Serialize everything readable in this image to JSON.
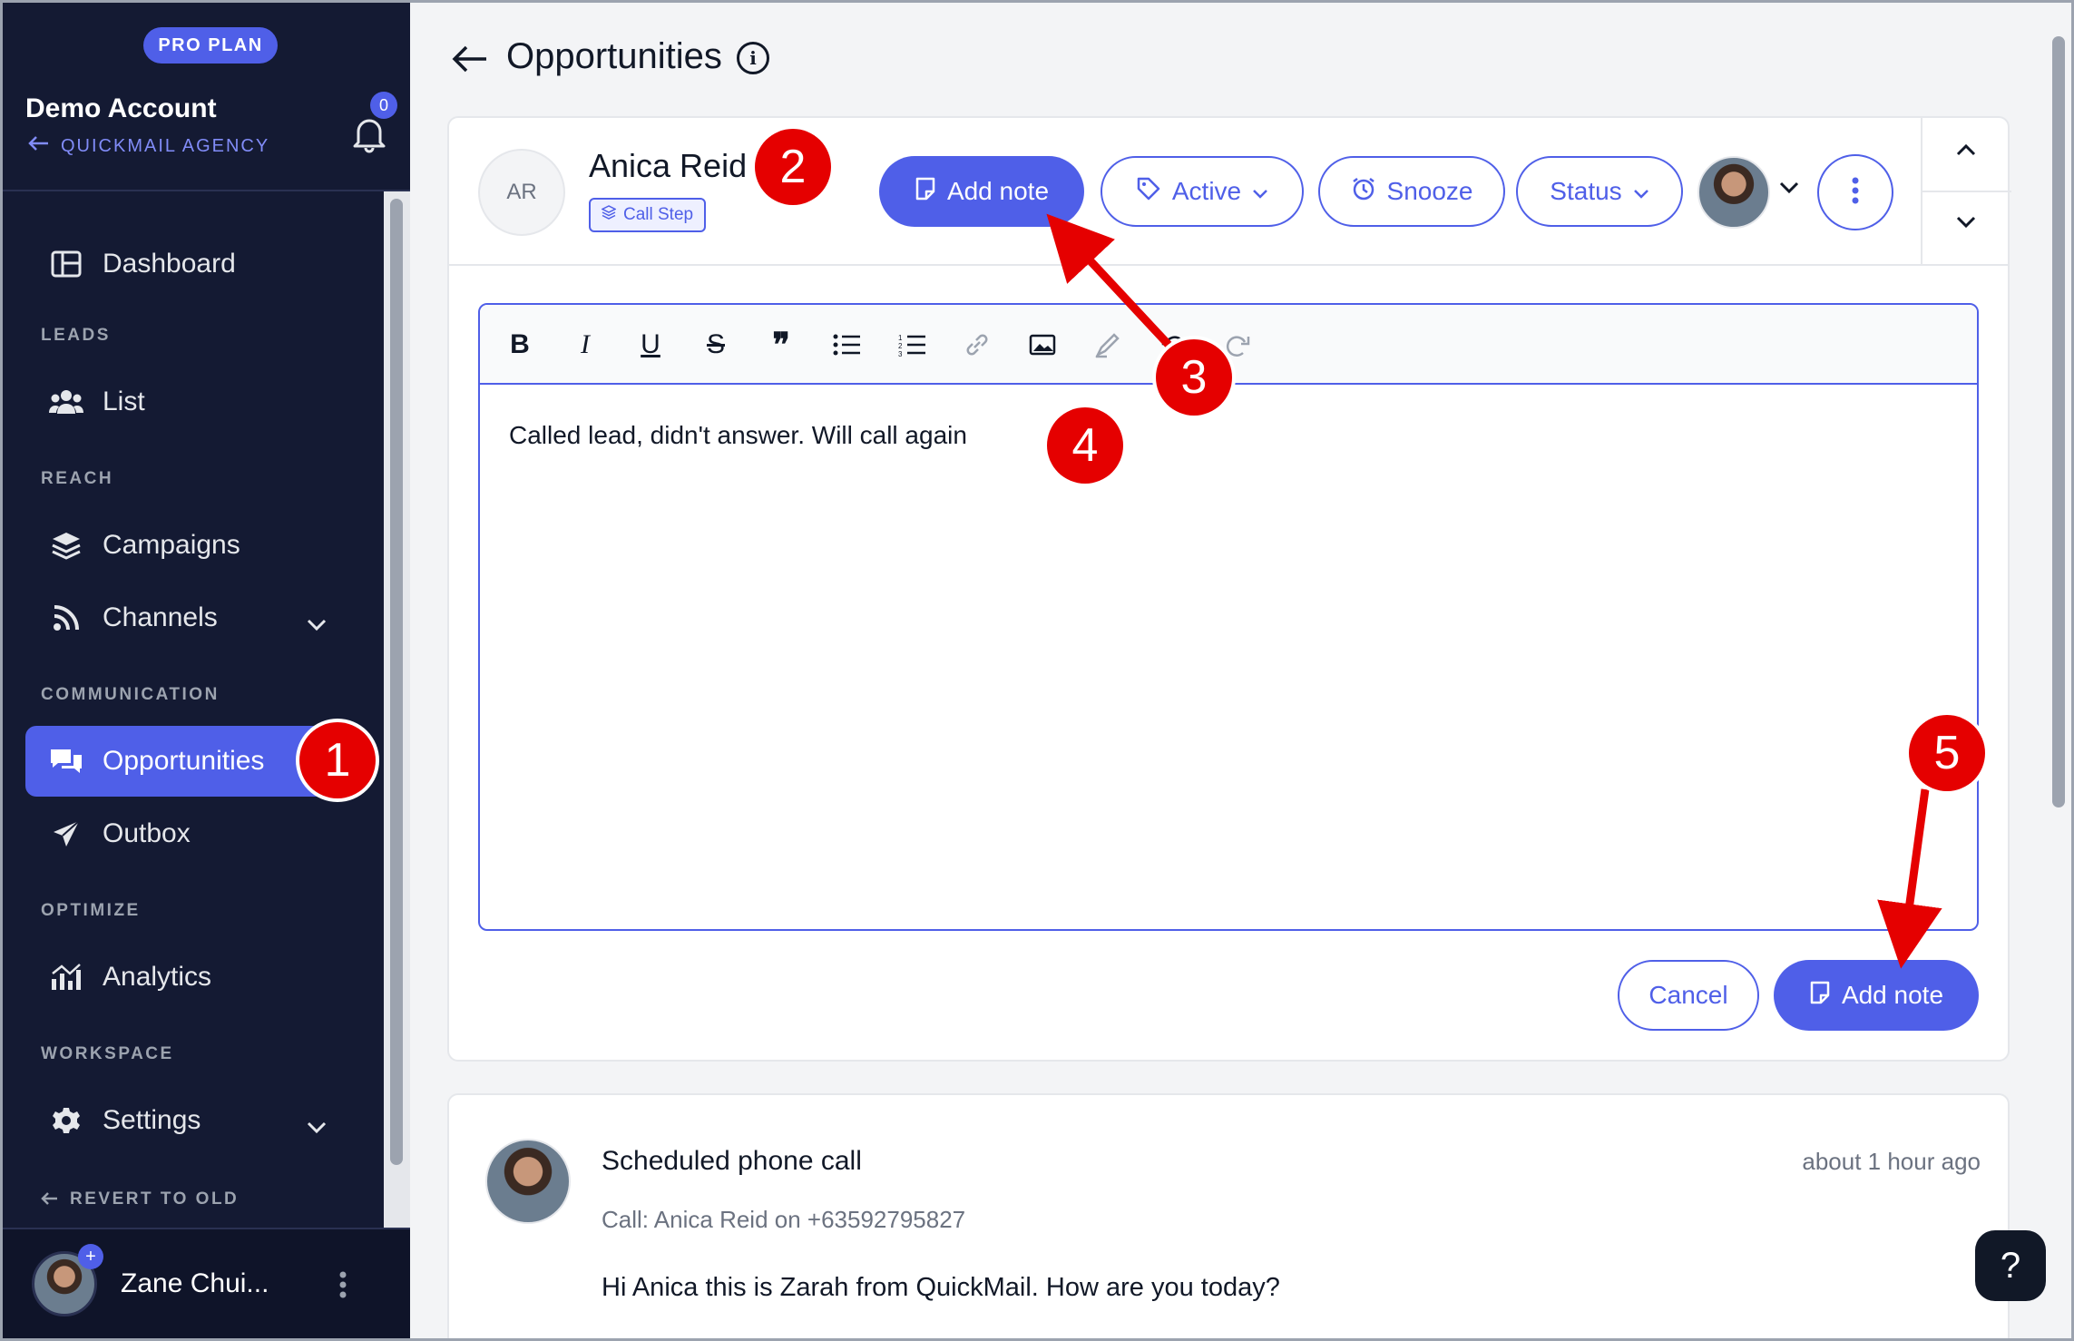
{
  "sidebar": {
    "plan_badge": "PRO PLAN",
    "account_name": "Demo Account",
    "agency": "QUICKMAIL AGENCY",
    "notification_count": "0",
    "sections": {
      "leads": "LEADS",
      "reach": "REACH",
      "communication": "COMMUNICATION",
      "optimize": "OPTIMIZE",
      "workspace": "WORKSPACE"
    },
    "items": [
      {
        "label": "Dashboard"
      },
      {
        "label": "List"
      },
      {
        "label": "Campaigns"
      },
      {
        "label": "Channels"
      },
      {
        "label": "Opportunities"
      },
      {
        "label": "Outbox"
      },
      {
        "label": "Analytics"
      },
      {
        "label": "Settings"
      }
    ],
    "revert_label": "REVERT TO OLD INTERFACE",
    "user_name": "Zane Chui...",
    "user_plus": "+"
  },
  "header": {
    "title": "Opportunities",
    "info": "i"
  },
  "lead": {
    "initials": "AR",
    "name": "Anica Reid",
    "tag": "Call Step",
    "add_note": "Add note",
    "active": "Active",
    "snooze": "Snooze",
    "status": "Status"
  },
  "editor": {
    "text": "Called lead, didn't answer. Will call again",
    "toolbar": [
      "bold-icon",
      "italic-icon",
      "underline-icon",
      "strikethrough-icon",
      "quote-icon",
      "bullet-list-icon",
      "numbered-list-icon",
      "link-icon",
      "image-icon",
      "clear-format-icon",
      "undo-icon",
      "redo-icon"
    ]
  },
  "actions": {
    "cancel": "Cancel",
    "add_note": "Add note"
  },
  "activity": {
    "title": "Scheduled phone call",
    "time": "about 1 hour ago",
    "subtitle": "Call: Anica Reid on +63592795827",
    "body": "Hi Anica this is Zarah from QuickMail. How are you today?"
  },
  "help": "?",
  "annotations": [
    "1",
    "2",
    "3",
    "4",
    "5"
  ],
  "colors": {
    "accent": "#4f5fe8",
    "sidebar_bg": "#141a33",
    "annotation_red": "#e50000"
  }
}
